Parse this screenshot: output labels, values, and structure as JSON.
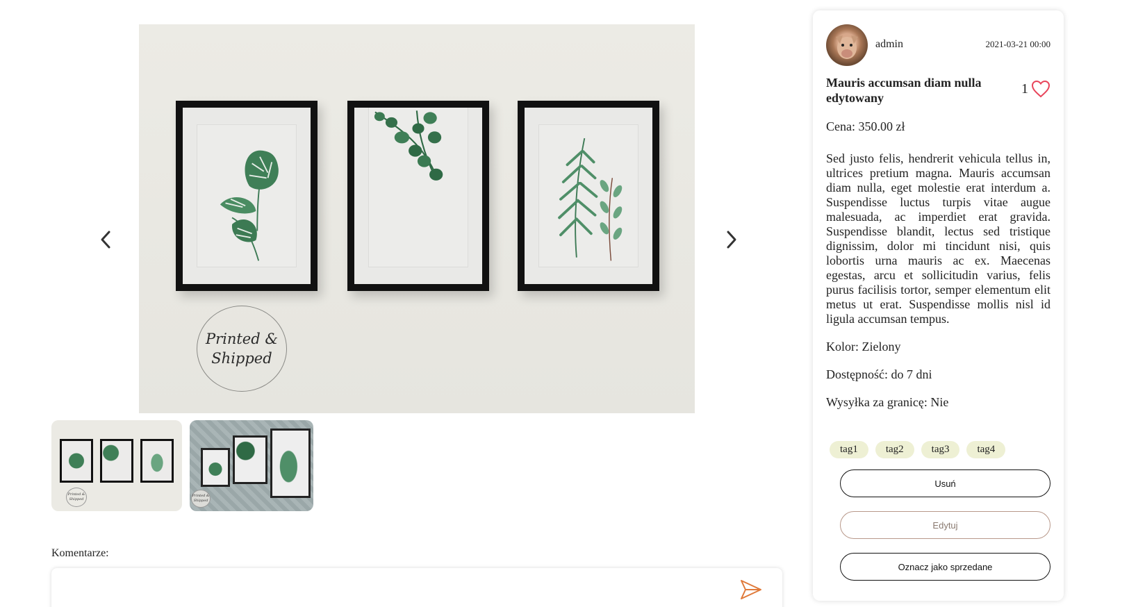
{
  "gallery": {
    "main_stamp_line1": "Printed &",
    "main_stamp_line2": "Shipped",
    "thumb1_stamp": "Printed & Shipped",
    "thumb2_stamp": "Printed & Shipped"
  },
  "comments": {
    "label": "Komentarze:",
    "placeholder": ""
  },
  "post": {
    "author": "admin",
    "date": "2021-03-21 00:00",
    "title": "Mauris accumsan diam nulla edytowany",
    "likes": "1",
    "price": "Cena: 350.00 zł",
    "description": "Sed justo felis, hendrerit vehicula tellus in, ultrices pretium magna. Mauris accumsan diam nulla, eget molestie erat interdum a. Suspendisse luctus turpis vitae augue malesuada, ac imperdiet erat gravida. Suspendisse blandit, lectus sed tristique dignissim, dolor mi tincidunt nisi, quis lobortis urna mauris ac ex. Maecenas egestas, arcu et sollicitudin varius, felis purus facilisis tortor, semper elementum elit metus ut erat. Suspendisse mollis nisl id ligula accumsan tempus.",
    "color": "Kolor: Zielony",
    "availability": "Dostępność: do 7 dni",
    "shipping_abroad": "Wysyłka za granicę: Nie",
    "tags": [
      "tag1",
      "tag2",
      "tag3",
      "tag4"
    ]
  },
  "actions": {
    "delete": "Usuń",
    "edit": "Edytuj",
    "mark_sold": "Oznacz jako sprzedane"
  },
  "colors": {
    "heart": "#e8445a",
    "send": "#e07a3a",
    "tag_bg": "#eef0d4",
    "edit_border": "#b8988a"
  },
  "icons": {
    "prev": "chevron-left-icon",
    "next": "chevron-right-icon",
    "like": "heart-icon",
    "send": "send-icon"
  }
}
